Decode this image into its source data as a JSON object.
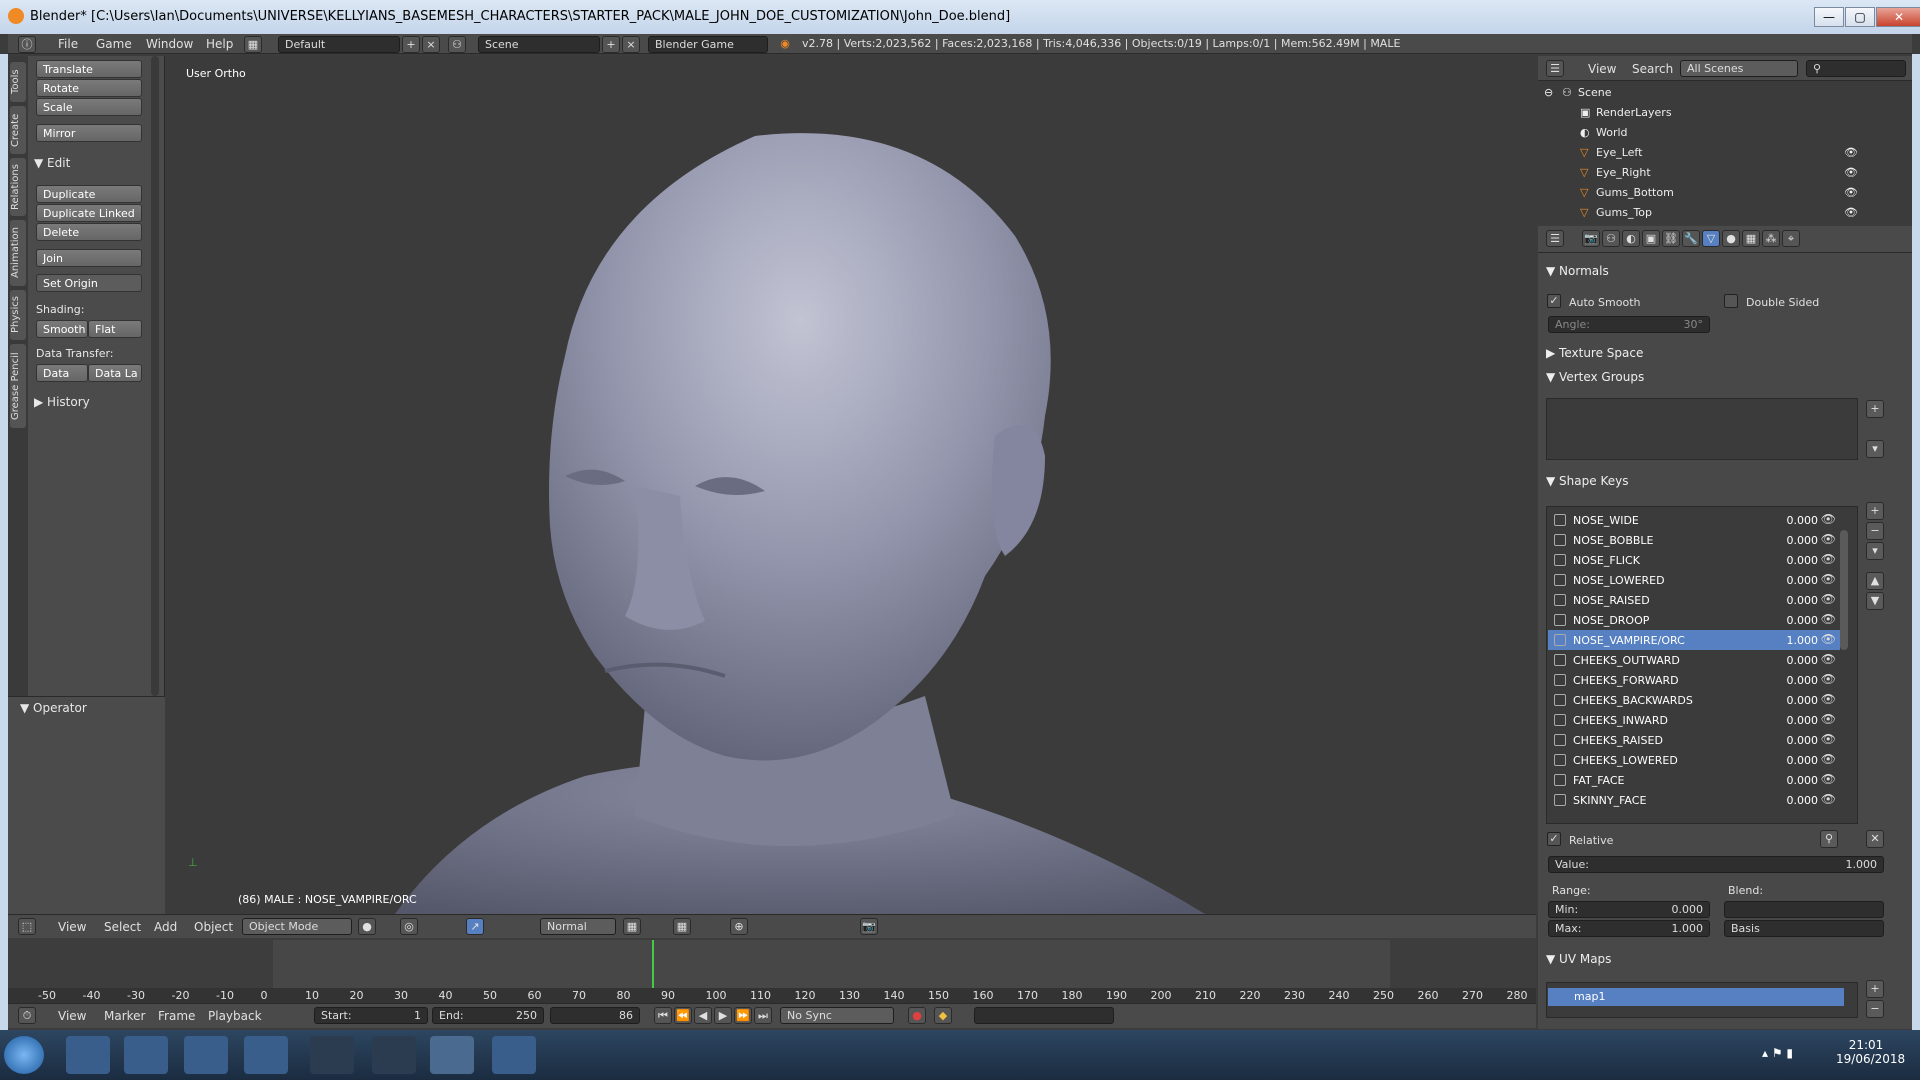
{
  "window": {
    "title": "Blender* [C:\\Users\\Ian\\Documents\\UNIVERSE\\KELLYIANS_BASEMESH_CHARACTERS\\STARTER_PACK\\MALE_JOHN_DOE_CUSTOMIZATION\\John_Doe.blend]",
    "minimize": "—",
    "maximize": "▢",
    "close": "✕"
  },
  "info": {
    "menus": [
      "File",
      "Game",
      "Window",
      "Help"
    ],
    "screen": "Default",
    "scene": "Scene",
    "engine": "Blender Game",
    "stats": "v2.78 | Verts:2,023,562 | Faces:2,023,168 | Tris:4,046,336 | Objects:0/19 | Lamps:0/1 | Mem:562.49M | MALE"
  },
  "toolshelf": {
    "tabs": [
      "Tools",
      "Create",
      "Relations",
      "Animation",
      "Physics",
      "Grease Pencil"
    ],
    "transform": [
      "Translate",
      "Rotate",
      "Scale"
    ],
    "mirror": "Mirror",
    "edit_header": "Edit",
    "edit": [
      "Duplicate",
      "Duplicate Linked",
      "Delete"
    ],
    "join": "Join",
    "set_origin": "Set Origin",
    "shading_label": "Shading:",
    "smooth": "Smooth",
    "flat": "Flat",
    "data_transfer_label": "Data Transfer:",
    "data": "Data",
    "data_la": "Data La",
    "history": "History",
    "operator": "Operator"
  },
  "viewport": {
    "view_label": "User Ortho",
    "status": "(86) MALE : NOSE_VAMPIRE/ORC",
    "header": {
      "menus": [
        "View",
        "Select",
        "Add",
        "Object"
      ],
      "mode": "Object Mode",
      "pivot": "Normal"
    }
  },
  "timeline": {
    "ticks": [
      "-50",
      "-40",
      "-30",
      "-20",
      "-10",
      "0",
      "10",
      "20",
      "30",
      "40",
      "50",
      "60",
      "70",
      "80",
      "90",
      "100",
      "110",
      "120",
      "130",
      "140",
      "150",
      "160",
      "170",
      "180",
      "190",
      "200",
      "210",
      "220",
      "230",
      "240",
      "250",
      "260",
      "270",
      "280"
    ],
    "menus": [
      "View",
      "Marker",
      "Frame",
      "Playback"
    ],
    "start_label": "Start:",
    "start": "1",
    "end_label": "End:",
    "end": "250",
    "current": "86",
    "sync": "No Sync"
  },
  "outliner": {
    "menus": [
      "View",
      "Search"
    ],
    "filter": "All Scenes",
    "items": [
      "Scene",
      "RenderLayers",
      "World",
      "Eye_Left",
      "Eye_Right",
      "Gums_Bottom",
      "Gums_Top"
    ]
  },
  "properties": {
    "normals": "Normals",
    "auto_smooth": "Auto Smooth",
    "double_sided": "Double Sided",
    "angle_label": "Angle:",
    "angle": "30°",
    "texture_space": "Texture Space",
    "vertex_groups": "Vertex Groups",
    "shape_keys": "Shape Keys",
    "keys": [
      {
        "name": "NOSE_WIDE",
        "value": "0.000"
      },
      {
        "name": "NOSE_BOBBLE",
        "value": "0.000"
      },
      {
        "name": "NOSE_FLICK",
        "value": "0.000"
      },
      {
        "name": "NOSE_LOWERED",
        "value": "0.000"
      },
      {
        "name": "NOSE_RAISED",
        "value": "0.000"
      },
      {
        "name": "NOSE_DROOP",
        "value": "0.000"
      },
      {
        "name": "NOSE_VAMPIRE/ORC",
        "value": "1.000"
      },
      {
        "name": "CHEEKS_OUTWARD",
        "value": "0.000"
      },
      {
        "name": "CHEEKS_FORWARD",
        "value": "0.000"
      },
      {
        "name": "CHEEKS_BACKWARDS",
        "value": "0.000"
      },
      {
        "name": "CHEEKS_INWARD",
        "value": "0.000"
      },
      {
        "name": "CHEEKS_RAISED",
        "value": "0.000"
      },
      {
        "name": "CHEEKS_LOWERED",
        "value": "0.000"
      },
      {
        "name": "FAT_FACE",
        "value": "0.000"
      },
      {
        "name": "SKINNY_FACE",
        "value": "0.000"
      }
    ],
    "relative": "Relative",
    "value_label": "Value:",
    "value": "1.000",
    "range_label": "Range:",
    "blend_label": "Blend:",
    "min_label": "Min:",
    "min": "0.000",
    "max_label": "Max:",
    "max": "1.000",
    "blend": "Basis",
    "uv_maps": "UV Maps",
    "uv_map": "map1"
  },
  "taskbar": {
    "time": "21:01",
    "date": "19/06/2018"
  },
  "colors": {
    "selected": "#5680c2",
    "accent": "#f08a24",
    "frame_marker": "#46c846"
  }
}
